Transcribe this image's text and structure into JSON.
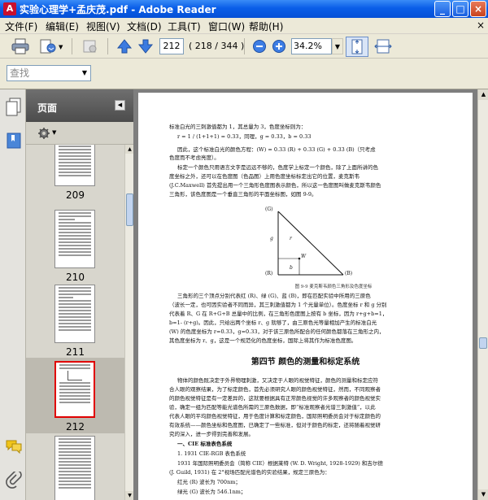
{
  "window": {
    "title": "实验心理学+孟庆茂.pdf - Adobe Reader",
    "app_icon_glyph": "A",
    "min_glyph": "_",
    "max_glyph": "□",
    "close_glyph": "×"
  },
  "menu": {
    "items": [
      "文件(F)",
      "编辑(E)",
      "视图(V)",
      "文档(D)",
      "工具(T)",
      "窗口(W)",
      "帮助(H)"
    ],
    "close_glyph": "×"
  },
  "toolbar": {
    "current_page": "212",
    "page_count": "( 218 / 344 )",
    "zoom": "34.2%",
    "zoom_drop_glyph": "▼",
    "icons": [
      "print-icon",
      "email-icon",
      "collaborate-icon",
      "prev-page-icon",
      "next-page-icon",
      "zoom-out-icon",
      "zoom-in-icon",
      "fit-page-icon",
      "fit-width-icon"
    ]
  },
  "search": {
    "placeholder": "查找",
    "drop_glyph": "▼"
  },
  "panel": {
    "title": "页面",
    "collapse_glyph": "◀",
    "options_drop_glyph": "▼",
    "thumbnails": [
      {
        "label": "209",
        "selected": false
      },
      {
        "label": "210",
        "selected": false
      },
      {
        "label": "211",
        "selected": false
      },
      {
        "label": "212",
        "selected": true
      }
    ]
  },
  "document": {
    "lines_top": [
      "标准白光的三刺激值都为 1，其总量为 3，色度坐标则为：",
      "r = 1 / (1+1+1) = 0.33，同理，g = 0.33，b = 0.33",
      "因此，这个标准白光的颜色方程：(W) = 0.33 (R) + 0.33 (G) + 0.33 (B)（只考虑",
      "色度而不考虑亮度）。",
      "标定一个颜色只用语言文字是远远不够的，色度学上标定一个颜色，除了上面所讲的色",
      "度坐标之外，还可以在色度图（色品图）上用色度坐标标定出它的位置，麦克斯韦",
      "(J.C.Maxwell) 首先提出用一个三角形色度图表示颜色，所以这一色度图叫做麦克斯韦颜色",
      "三角形，该色度图是一个垂直三角形的平面坐标图，如图 9-9。"
    ],
    "figure": {
      "labels": [
        "(G)",
        "(R)",
        "(B)",
        "g",
        "r",
        "W",
        "b"
      ],
      "caption": "图 9-9  麦克斯韦颜色三角形及色度坐标"
    },
    "lines_mid": [
      "三角形的三个顶点分别代表红 (R)、绿 (G)、蓝 (B)，即在匹配实验中所用的三原色",
      "（波长一定，也可因实验者不同而异，其三刺激值都为 1 个光量单位）。色度坐标 r 和 g 分别",
      "代表着 R、G 在 R+G+B 总量中的比例，在三角形色度图上按有 b 坐标，因为 r+g+b=1，",
      "b=1- (r+g)。因此，只给出两个坐标 r、g 就够了，由三原色光等量相加产生的标准白光",
      "(W) 的色度坐标为 r=0.33，g=0.33，对于该三原色所配合的任何颜色都落在三角形之内，",
      "其色度坐标为 r、g，这是一个规范化的色度坐标，国际上将其作为标准色度图。"
    ],
    "section_heading": "第四节   颜色的测量和标定系统",
    "lines_bottom": [
      "物体的颜色既决定于外界物理刺激，又决定于人眼的视觉特征，颜色的测量和标定应符",
      "合人眼的观察结果，为了标定颜色，首先必须研究人眼的颜色视觉特征，然而，不同观察者",
      "的颜色视觉特征是有一定差异的，这就要根据具有正常颜色视觉的许多观察者的颜色视觉实",
      "验，确定一组为匹配等能光谱色所需的三原色数据，即“标准观察者光谱三刺激值”，以此",
      "代表人眼的平均颜色视觉特征，用于色度计算和标定颜色，国际照明委员会对于标定颜色的",
      "有效系统——颜色坐标和色度图，已确定了一些标准，但对于颜色的标定，还将随着视觉研",
      "究的深入，进一步得到完善和发展。",
      "一、CIE 标准表色系统",
      "1. 1931 CIE-RGB 表色系统",
      "1931 年国际照明委员会（简称 CIE）根据莱特 (W. D. Wright, 1928-1929) 和吉尔德",
      "(J. Guild, 1931) 在 2°视场匹配光谱色的实验结果，规定三原色为：",
      "红光 (R) 波长为 700nm；",
      "绿光 (G) 波长为 546.1nm；"
    ]
  }
}
